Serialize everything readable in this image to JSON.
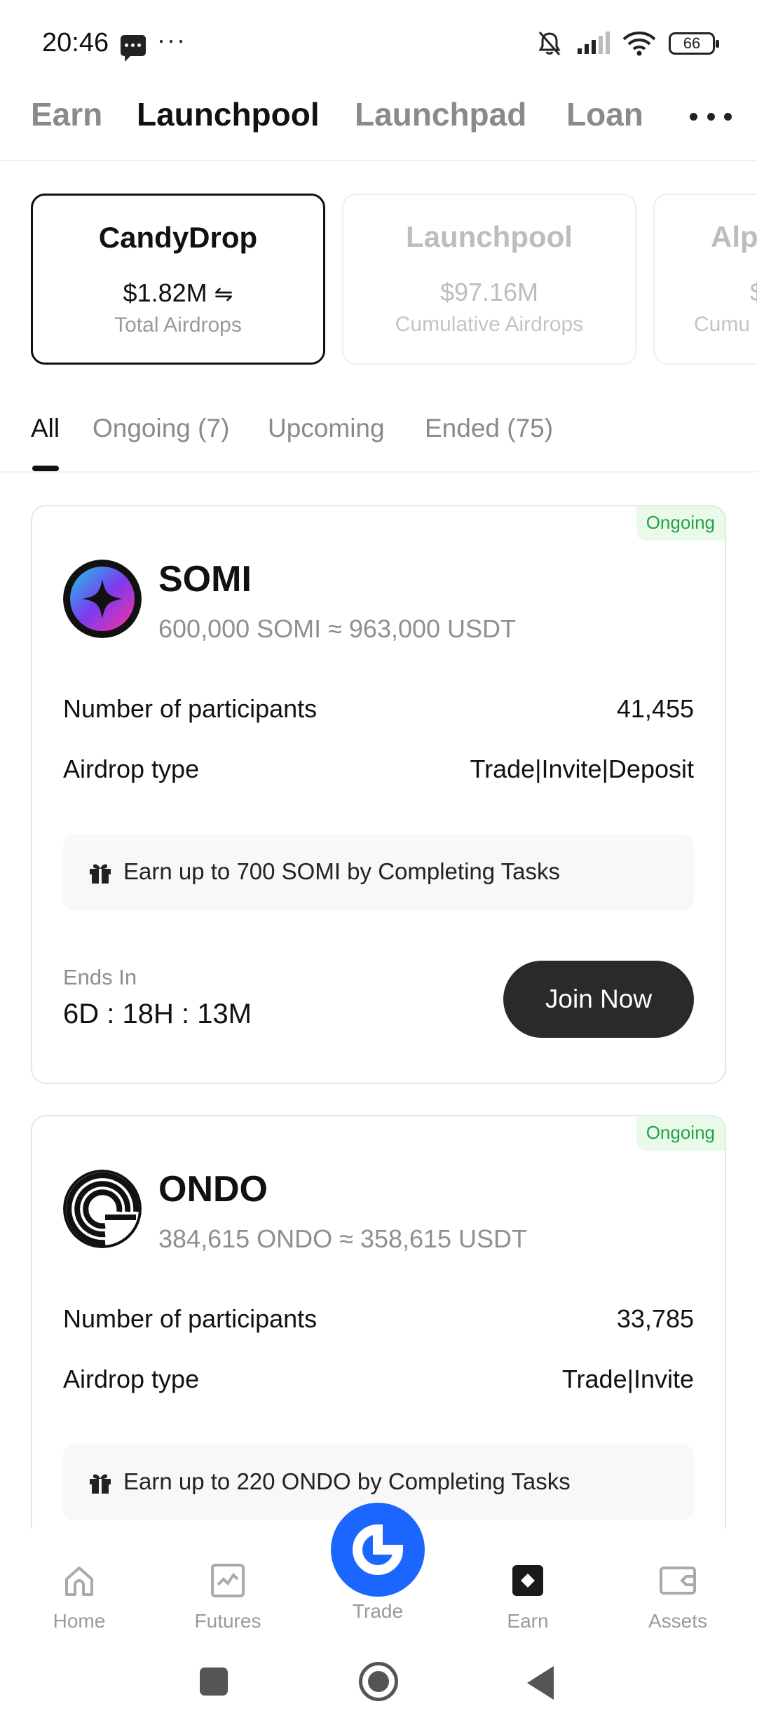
{
  "status_bar": {
    "time": "20:46",
    "battery": "66",
    "icons": [
      "message-icon",
      "more-dots-icon",
      "bell-off-icon",
      "signal-icon",
      "wifi-icon",
      "battery-icon"
    ]
  },
  "top_tabs": [
    {
      "label": "Earn",
      "active": false
    },
    {
      "label": "Launchpool",
      "active": true
    },
    {
      "label": "Launchpad",
      "active": false
    },
    {
      "label": "Loan",
      "active": false
    }
  ],
  "summary_cards": [
    {
      "title": "CandyDrop",
      "value": "$1.82M",
      "subtitle": "Total Airdrops",
      "active": true
    },
    {
      "title": "Launchpool",
      "value": "$97.16M",
      "subtitle": "Cumulative Airdrops",
      "active": false
    },
    {
      "title": "Alp",
      "value": "$",
      "subtitle": "Cumu",
      "active": false
    }
  ],
  "filter_tabs": [
    {
      "label": "All",
      "active": true
    },
    {
      "label": "Ongoing (7)",
      "active": false
    },
    {
      "label": "Upcoming",
      "active": false
    },
    {
      "label": "Ended (75)",
      "active": false
    }
  ],
  "airdrops": [
    {
      "status": "Ongoing",
      "name": "SOMI",
      "amount": "600,000 SOMI ≈ 963,000 USDT",
      "participants_label": "Number of participants",
      "participants": "41,455",
      "type_label": "Airdrop type",
      "type": "Trade|Invite|Deposit",
      "task": "Earn up to 700 SOMI by Completing Tasks",
      "ends_label": "Ends In",
      "ends_value": "6D : 18H : 13M",
      "button": "Join Now"
    },
    {
      "status": "Ongoing",
      "name": "ONDO",
      "amount": "384,615 ONDO ≈ 358,615 USDT",
      "participants_label": "Number of participants",
      "participants": "33,785",
      "type_label": "Airdrop type",
      "type": "Trade|Invite",
      "task": "Earn up to 220 ONDO by Completing Tasks"
    }
  ],
  "bottom_nav": [
    {
      "label": "Home",
      "icon": "home-icon"
    },
    {
      "label": "Futures",
      "icon": "futures-icon"
    },
    {
      "label": "Trade",
      "icon": "trade-logo-icon"
    },
    {
      "label": "Earn",
      "icon": "earn-icon"
    },
    {
      "label": "Assets",
      "icon": "assets-icon"
    }
  ],
  "colors": {
    "accent": "#1a66ff",
    "ongoing_green": "#25a244",
    "button_dark": "#2a2a2a"
  }
}
